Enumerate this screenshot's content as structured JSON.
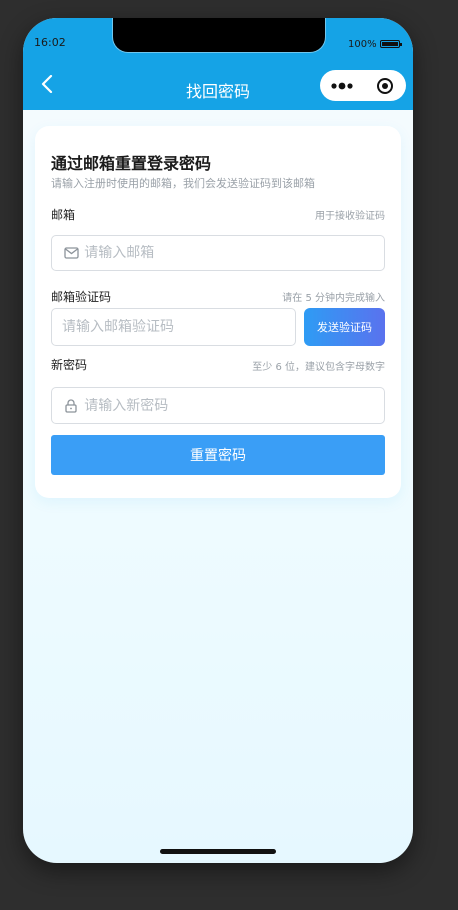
{
  "statusbar": {
    "time": "16:02",
    "battery_percent": "100%",
    "battery_level": 1.0
  },
  "navbar": {
    "title": "找回密码",
    "back_icon": "chevron-left-icon",
    "more_icon": "more-dots-icon",
    "close_icon": "target-circle-icon"
  },
  "form": {
    "title": "通过邮箱重置登录密码",
    "subtitle": "请输入注册时使用的邮箱，我们会发送验证码到该邮箱",
    "email": {
      "label": "邮箱",
      "hint": "用于接收验证码",
      "placeholder": "请输入邮箱",
      "value": "",
      "icon": "mail-icon"
    },
    "code": {
      "label": "邮箱验证码",
      "hint": "请在 5 分钟内完成输入",
      "placeholder": "请输入邮箱验证码",
      "value": "",
      "send_button": "发送验证码"
    },
    "password": {
      "label": "新密码",
      "hint": "至少 6 位，建议包含字母数字",
      "placeholder": "请输入新密码",
      "value": "",
      "icon": "lock-icon"
    },
    "submit_button": "重置密码"
  },
  "colors": {
    "primary": "#15a3e6",
    "button": "#3a9ef6",
    "gradient_start": "#2e9cf4",
    "gradient_end": "#5a72ee"
  }
}
